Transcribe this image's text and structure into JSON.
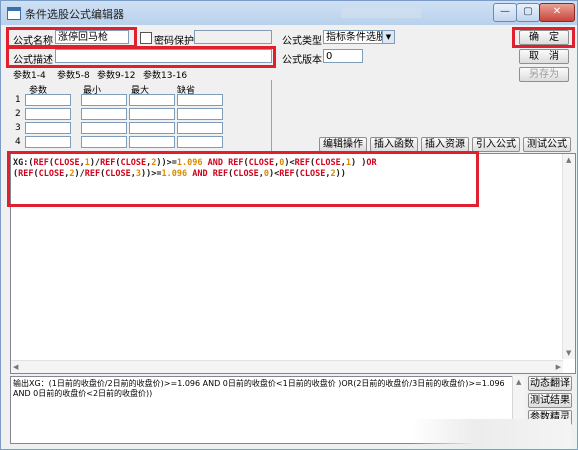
{
  "window": {
    "title": "条件选股公式编辑器",
    "minimize_label": "—",
    "maximize_label": "▢",
    "close_label": "✕"
  },
  "form": {
    "name_label": "公式名称",
    "name_value": "涨停回马枪",
    "password_label": "密码保护",
    "password_value": "",
    "type_label": "公式类型",
    "type_value": "指标条件选股",
    "desc_label": "公式描述",
    "desc_value": "",
    "version_label": "公式版本",
    "version_value": "0"
  },
  "buttons": {
    "ok": "确　定",
    "cancel": "取　消",
    "save_as": "另存为",
    "edit_op": "编辑操作",
    "insert_func": "插入函数",
    "insert_resource": "插入资源",
    "import_formula": "引入公式",
    "test_formula": "测试公式",
    "dynamic_translate": "动态翻译",
    "test_result": "测试结果",
    "param_wizard": "参数精灵"
  },
  "param_tabs": [
    "参数1-4",
    "参数5-8",
    "参数9-12",
    "参数13-16"
  ],
  "param_table": {
    "headers": [
      "参数",
      "最小",
      "最大",
      "缺省"
    ],
    "rows": [
      "1",
      "2",
      "3",
      "4"
    ]
  },
  "code": {
    "line1": [
      {
        "t": "XG:(",
        "c": "black"
      },
      {
        "t": "REF",
        "c": "red"
      },
      {
        "t": "(",
        "c": "black"
      },
      {
        "t": "CLOSE",
        "c": "red"
      },
      {
        "t": ",",
        "c": "black"
      },
      {
        "t": "1",
        "c": "orange"
      },
      {
        "t": ")/",
        "c": "black"
      },
      {
        "t": "REF",
        "c": "red"
      },
      {
        "t": "(",
        "c": "black"
      },
      {
        "t": "CLOSE",
        "c": "red"
      },
      {
        "t": ",",
        "c": "black"
      },
      {
        "t": "2",
        "c": "orange"
      },
      {
        "t": "))>=",
        "c": "black"
      },
      {
        "t": "1.096",
        "c": "orange"
      },
      {
        "t": " ",
        "c": "black"
      },
      {
        "t": "AND",
        "c": "red"
      },
      {
        "t": " ",
        "c": "black"
      },
      {
        "t": "REF",
        "c": "red"
      },
      {
        "t": "(",
        "c": "black"
      },
      {
        "t": "CLOSE",
        "c": "red"
      },
      {
        "t": ",",
        "c": "black"
      },
      {
        "t": "0",
        "c": "orange"
      },
      {
        "t": ")<",
        "c": "black"
      },
      {
        "t": "REF",
        "c": "red"
      },
      {
        "t": "(",
        "c": "black"
      },
      {
        "t": "CLOSE",
        "c": "red"
      },
      {
        "t": ",",
        "c": "black"
      },
      {
        "t": "1",
        "c": "orange"
      },
      {
        "t": ") )",
        "c": "black"
      },
      {
        "t": "OR",
        "c": "red"
      }
    ],
    "line2": [
      {
        "t": "(",
        "c": "black"
      },
      {
        "t": "REF",
        "c": "red"
      },
      {
        "t": "(",
        "c": "black"
      },
      {
        "t": "CLOSE",
        "c": "red"
      },
      {
        "t": ",",
        "c": "black"
      },
      {
        "t": "2",
        "c": "orange"
      },
      {
        "t": ")/",
        "c": "black"
      },
      {
        "t": "REF",
        "c": "red"
      },
      {
        "t": "(",
        "c": "black"
      },
      {
        "t": "CLOSE",
        "c": "red"
      },
      {
        "t": ",",
        "c": "black"
      },
      {
        "t": "3",
        "c": "orange"
      },
      {
        "t": "))>=",
        "c": "black"
      },
      {
        "t": "1.096",
        "c": "orange"
      },
      {
        "t": " ",
        "c": "black"
      },
      {
        "t": "AND",
        "c": "red"
      },
      {
        "t": " ",
        "c": "black"
      },
      {
        "t": "REF",
        "c": "red"
      },
      {
        "t": "(",
        "c": "black"
      },
      {
        "t": "CLOSE",
        "c": "red"
      },
      {
        "t": ",",
        "c": "black"
      },
      {
        "t": "0",
        "c": "orange"
      },
      {
        "t": ")<",
        "c": "black"
      },
      {
        "t": "REF",
        "c": "red"
      },
      {
        "t": "(",
        "c": "black"
      },
      {
        "t": "CLOSE",
        "c": "red"
      },
      {
        "t": ",",
        "c": "black"
      },
      {
        "t": "2",
        "c": "orange"
      },
      {
        "t": "))",
        "c": "black"
      }
    ]
  },
  "output_text": "输出XG：(1日前的收盘价/2日前的收盘价)>=1.096 AND 0日前的收盘价<1日前的收盘价 )OR(2日前的收盘价/3日前的收盘价)>=1.096 AND 0日前的收盘价<2日前的收盘价))",
  "colors": {
    "black": "#1a1a1a",
    "red": "#d0021b",
    "orange": "#d98a00",
    "highlight_box": "#e0202c"
  }
}
